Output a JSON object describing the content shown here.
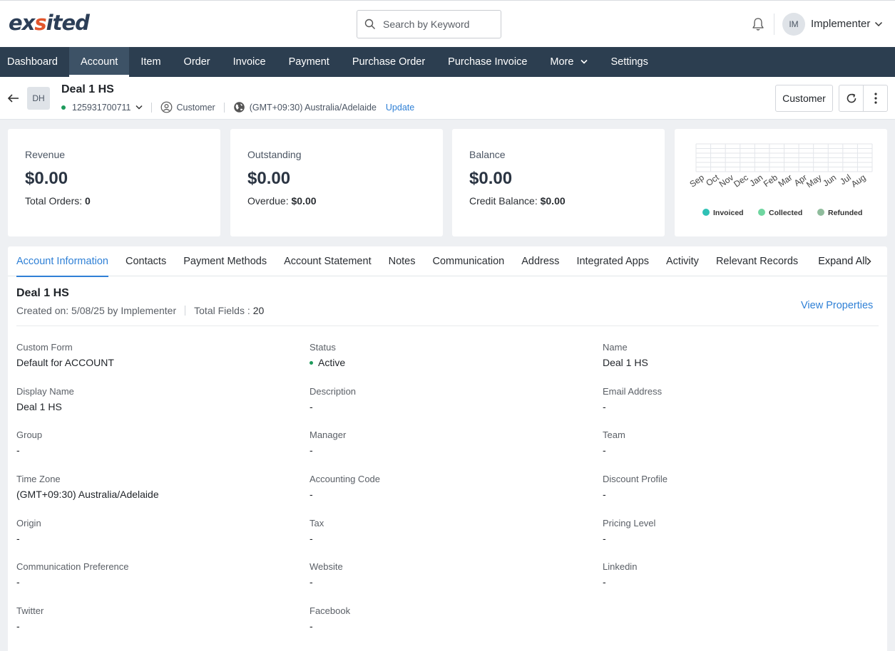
{
  "brand": {
    "logo_pre": "ex",
    "logo_mid": "s",
    "logo_post": "ited"
  },
  "search": {
    "placeholder": "Search by Keyword"
  },
  "user": {
    "initials": "IM",
    "name": "Implementer"
  },
  "nav": {
    "items": [
      "Dashboard",
      "Account",
      "Item",
      "Order",
      "Invoice",
      "Payment",
      "Purchase Order",
      "Purchase Invoice",
      "More",
      "Settings"
    ],
    "active": "Account"
  },
  "record": {
    "initials": "DH",
    "title": "Deal 1 HS",
    "phone": "125931700711",
    "type": "Customer",
    "timezone": "(GMT+09:30) Australia/Adelaide",
    "update_label": "Update",
    "customer_button": "Customer"
  },
  "kpis": {
    "revenue": {
      "label": "Revenue",
      "amount": "$0.00",
      "sub_label": "Total Orders:",
      "sub_value": "0"
    },
    "outstanding": {
      "label": "Outstanding",
      "amount": "$0.00",
      "sub_label": "Overdue:",
      "sub_value": "$0.00"
    },
    "balance": {
      "label": "Balance",
      "amount": "$0.00",
      "sub_label": "Credit Balance:",
      "sub_value": "$0.00"
    }
  },
  "chart_data": {
    "type": "bar",
    "categories": [
      "Sep",
      "Oct",
      "Nov",
      "Dec",
      "Jan",
      "Feb",
      "Mar",
      "Apr",
      "May",
      "Jun",
      "Jul",
      "Aug"
    ],
    "series": [
      {
        "name": "Invoiced",
        "color": "#2fc1b5",
        "values": [
          0,
          0,
          0,
          0,
          0,
          0,
          0,
          0,
          0,
          0,
          0,
          0
        ]
      },
      {
        "name": "Collected",
        "color": "#6fd6a0",
        "values": [
          0,
          0,
          0,
          0,
          0,
          0,
          0,
          0,
          0,
          0,
          0,
          0
        ]
      },
      {
        "name": "Refunded",
        "color": "#8fbc9c",
        "values": [
          0,
          0,
          0,
          0,
          0,
          0,
          0,
          0,
          0,
          0,
          0,
          0
        ]
      }
    ],
    "grid": true,
    "legend": "bottom"
  },
  "tabs": {
    "items": [
      "Account Information",
      "Contacts",
      "Payment Methods",
      "Account Statement",
      "Notes",
      "Communication",
      "Address",
      "Integrated Apps",
      "Activity",
      "Relevant Records"
    ],
    "active": "Account Information",
    "expand_all": "Expand All"
  },
  "section": {
    "title": "Deal 1 HS",
    "created_on": "Created on: 5/08/25 by Implementer",
    "total_fields_label": "Total Fields :",
    "total_fields_value": "20",
    "view_properties": "View Properties"
  },
  "fields": [
    {
      "label": "Custom Form",
      "value": "Default for ACCOUNT"
    },
    {
      "label": "Status",
      "value": "Active",
      "status": true
    },
    {
      "label": "Name",
      "value": "Deal 1 HS"
    },
    {
      "label": "Display Name",
      "value": "Deal 1 HS"
    },
    {
      "label": "Description",
      "value": "-"
    },
    {
      "label": "Email Address",
      "value": "-"
    },
    {
      "label": "Group",
      "value": "-"
    },
    {
      "label": "Manager",
      "value": "-"
    },
    {
      "label": "Team",
      "value": "-"
    },
    {
      "label": "Time Zone",
      "value": "(GMT+09:30) Australia/Adelaide"
    },
    {
      "label": "Accounting Code",
      "value": "-"
    },
    {
      "label": "Discount Profile",
      "value": "-"
    },
    {
      "label": "Origin",
      "value": "-"
    },
    {
      "label": "Tax",
      "value": "-"
    },
    {
      "label": "Pricing Level",
      "value": "-"
    },
    {
      "label": "Communication Preference",
      "value": "-"
    },
    {
      "label": "Website",
      "value": "-"
    },
    {
      "label": "Linkedin",
      "value": "-"
    },
    {
      "label": "Twitter",
      "value": "-"
    },
    {
      "label": "Facebook",
      "value": "-"
    }
  ]
}
